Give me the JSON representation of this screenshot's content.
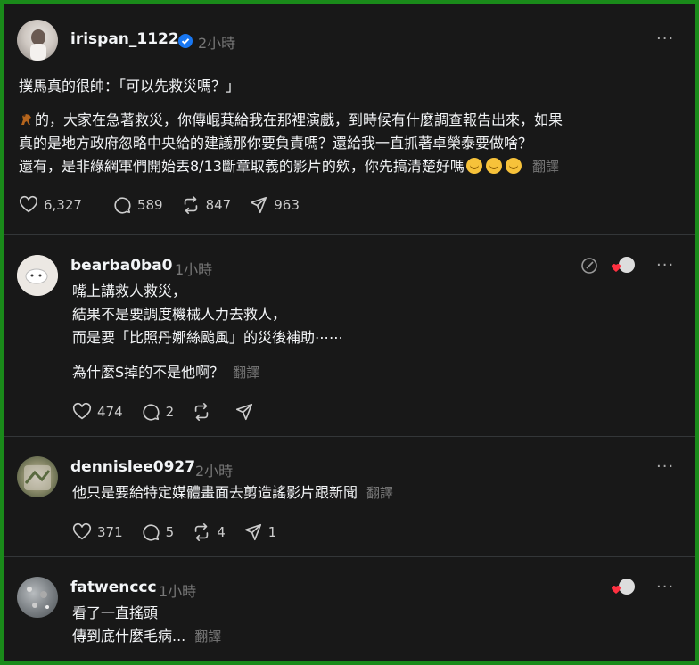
{
  "main_post": {
    "username": "irispan_1122",
    "time": "2小時",
    "line1": "撲馬真的很帥：「可以先救災嗎？」",
    "line2_prefix": "的，大家在急著救災，你傳崐萁給我在那裡演戲，到時候有什麼調查報告出來，如果",
    "line3": "真的是地方政府忽略中央給的建議那你要負責嗎？還給我一直抓著卓榮泰要做啥？",
    "line4": "還有，是非綠網軍們開始丟8/13斷章取義的影片的欸，你先搞清楚好嗎",
    "translate": "翻譯",
    "likes": "6,327",
    "comments": "589",
    "reposts": "847",
    "shares": "963",
    "verified_icon": "verified-badge-icon"
  },
  "replies": [
    {
      "username": "bearba0ba0",
      "time": "1小時",
      "lines": [
        "嘴上講救人救災，",
        "結果不是要調度機械人力去救人，",
        "而是要「比照丹娜絲颱風」的災後補助⋯⋯"
      ],
      "extra_line": "為什麼S掉的不是他啊？",
      "translate": "翻譯",
      "likes": "474",
      "comments": "2",
      "reposts": "",
      "shares": ""
    },
    {
      "username": "dennislee0927",
      "time": "2小時",
      "lines": [
        "他只是要給特定媒體畫面去剪造謠影片跟新聞"
      ],
      "translate": "翻譯",
      "likes": "371",
      "comments": "5",
      "reposts": "4",
      "shares": "1"
    },
    {
      "username": "fatwenccc",
      "time": "1小時",
      "lines": [
        "看了一直搖頭",
        "傳到底什麼毛病..."
      ],
      "translate": "翻譯"
    }
  ],
  "more_label": "···",
  "colors": {
    "background": "#181818",
    "text": "#f3f5f7",
    "muted": "#777777",
    "divider": "#333638",
    "border": "#1a8a1a"
  }
}
